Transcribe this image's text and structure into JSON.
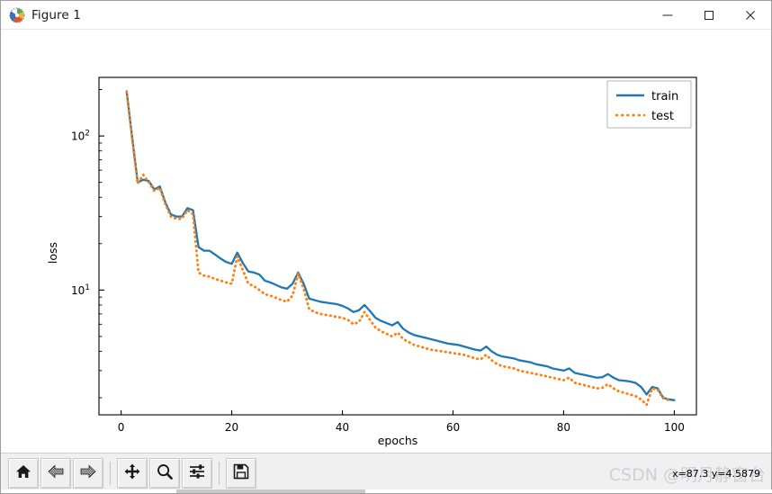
{
  "window": {
    "title": "Figure 1",
    "icon": "matplotlib-icon",
    "minimize_label": "—",
    "maximize_label": "□",
    "close_label": "✕"
  },
  "toolbar": {
    "buttons": [
      {
        "name": "home-button",
        "icon": "home-icon",
        "tooltip": "Home"
      },
      {
        "name": "back-button",
        "icon": "left-arrow-icon",
        "tooltip": "Back"
      },
      {
        "name": "forward-button",
        "icon": "right-arrow-icon",
        "tooltip": "Forward"
      },
      {
        "name": "pan-button",
        "icon": "move-cross-icon",
        "tooltip": "Pan"
      },
      {
        "name": "zoom-button",
        "icon": "magnifier-icon",
        "tooltip": "Zoom to rectangle"
      },
      {
        "name": "configure-subplots-button",
        "icon": "sliders-icon",
        "tooltip": "Configure subplots"
      },
      {
        "name": "save-button",
        "icon": "floppy-disk-icon",
        "tooltip": "Save the figure"
      }
    ],
    "coordinates": "x=87.3  y=4.5879",
    "watermark": "CSDN @明月静窗台"
  },
  "colors": {
    "train": "#1f77b4",
    "test": "#ff7f0e",
    "axis": "#000000",
    "background": "#ffffff",
    "toolbar_bg": "#f0f0f0",
    "watermark": "#cfcfd6"
  },
  "chart_data": {
    "type": "line",
    "title": "",
    "xlabel": "epochs",
    "ylabel": "loss",
    "yscale": "log",
    "xscale": "linear",
    "xlim": [
      -4,
      104
    ],
    "ylim": [
      1.55,
      240
    ],
    "xticks": [
      0,
      20,
      40,
      60,
      80,
      100
    ],
    "xticklabels": [
      "0",
      "20",
      "40",
      "60",
      "80",
      "100"
    ],
    "yticks": [
      10,
      100
    ],
    "yticklabels": [
      "10¹",
      "10²"
    ],
    "grid": false,
    "legend": {
      "position": "upper right",
      "entries": [
        "train",
        "test"
      ]
    },
    "x": [
      1,
      2,
      3,
      4,
      5,
      6,
      7,
      8,
      9,
      10,
      11,
      12,
      13,
      14,
      15,
      16,
      17,
      18,
      19,
      20,
      21,
      22,
      23,
      24,
      25,
      26,
      27,
      28,
      29,
      30,
      31,
      32,
      33,
      34,
      35,
      36,
      37,
      38,
      39,
      40,
      41,
      42,
      43,
      44,
      45,
      46,
      47,
      48,
      49,
      50,
      51,
      52,
      53,
      54,
      55,
      56,
      57,
      58,
      59,
      60,
      61,
      62,
      63,
      64,
      65,
      66,
      67,
      68,
      69,
      70,
      71,
      72,
      73,
      74,
      75,
      76,
      77,
      78,
      79,
      80,
      81,
      82,
      83,
      84,
      85,
      86,
      87,
      88,
      89,
      90,
      91,
      92,
      93,
      94,
      95,
      96,
      97,
      98,
      99,
      100
    ],
    "series": [
      {
        "name": "train",
        "style": "solid",
        "color": "#1f77b4",
        "values": [
          195,
          98,
          50,
          52,
          51,
          45,
          47,
          37,
          31,
          30,
          30,
          34,
          33,
          19,
          18,
          18,
          17,
          16,
          15.2,
          14.8,
          17.5,
          15.0,
          13.2,
          13.0,
          12.6,
          11.5,
          11.2,
          10.8,
          10.4,
          10.2,
          11.0,
          13.0,
          11.0,
          8.8,
          8.6,
          8.4,
          8.3,
          8.2,
          8.1,
          7.9,
          7.6,
          7.2,
          7.4,
          8.0,
          7.3,
          6.6,
          6.3,
          6.1,
          5.9,
          6.2,
          5.6,
          5.3,
          5.1,
          5.0,
          4.9,
          4.8,
          4.7,
          4.6,
          4.5,
          4.45,
          4.4,
          4.3,
          4.2,
          4.1,
          4.05,
          4.3,
          4.0,
          3.8,
          3.7,
          3.65,
          3.6,
          3.5,
          3.45,
          3.4,
          3.3,
          3.25,
          3.2,
          3.1,
          3.05,
          3.0,
          3.1,
          2.9,
          2.85,
          2.8,
          2.75,
          2.7,
          2.72,
          2.85,
          2.7,
          2.6,
          2.58,
          2.55,
          2.5,
          2.35,
          2.1,
          2.35,
          2.3,
          2.0,
          1.95,
          1.93
        ]
      },
      {
        "name": "test",
        "style": "dotted",
        "color": "#ff7f0e",
        "values": [
          193,
          96,
          49,
          56,
          50,
          44,
          46,
          36,
          30,
          29,
          29,
          33,
          31,
          13.0,
          12.4,
          12.2,
          11.8,
          11.5,
          11.2,
          11.0,
          16.5,
          13.5,
          11.0,
          10.6,
          10.0,
          9.4,
          9.2,
          8.9,
          8.6,
          8.4,
          9.2,
          12.8,
          10.2,
          7.5,
          7.2,
          7.0,
          6.9,
          6.8,
          6.7,
          6.6,
          6.4,
          6.0,
          6.2,
          7.2,
          6.4,
          5.7,
          5.4,
          5.2,
          5.0,
          5.3,
          4.8,
          4.6,
          4.4,
          4.3,
          4.2,
          4.1,
          4.05,
          4.0,
          3.95,
          3.9,
          3.85,
          3.8,
          3.7,
          3.6,
          3.55,
          3.8,
          3.5,
          3.3,
          3.2,
          3.15,
          3.1,
          3.0,
          2.95,
          2.9,
          2.85,
          2.8,
          2.75,
          2.7,
          2.65,
          2.6,
          2.7,
          2.5,
          2.45,
          2.4,
          2.35,
          2.3,
          2.32,
          2.45,
          2.3,
          2.2,
          2.15,
          2.1,
          2.05,
          1.95,
          1.8,
          2.3,
          2.25,
          1.98,
          1.93
        ]
      }
    ]
  }
}
